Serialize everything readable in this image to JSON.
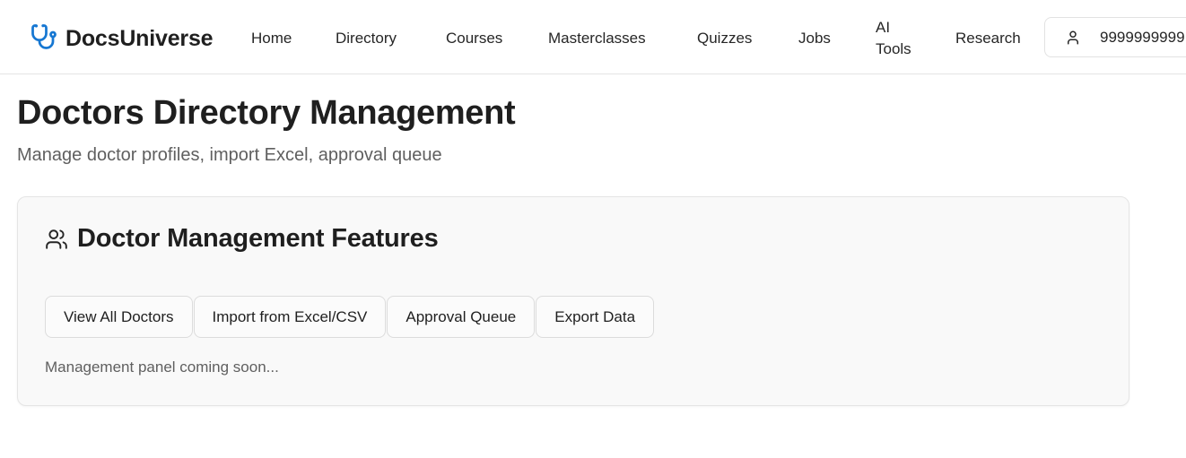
{
  "brand": {
    "name": "DocsUniverse",
    "icon": "stethoscope-icon",
    "color": "#1677d2"
  },
  "nav": {
    "home": "Home",
    "directory": "Directory",
    "courses": "Courses",
    "masterclasses": "Masterclasses",
    "quizzes": "Quizzes",
    "jobs": "Jobs",
    "ai_tools_line1": "AI",
    "ai_tools_line2": "Tools",
    "research": "Research"
  },
  "user": {
    "icon": "user-icon",
    "label": "9999999999"
  },
  "page": {
    "title": "Doctors Directory Management",
    "subtitle": "Manage doctor profiles, import Excel, approval queue"
  },
  "card": {
    "icon": "users-icon",
    "title": "Doctor Management Features",
    "buttons": {
      "view_all": "View All Doctors",
      "import": "Import from Excel/CSV",
      "approval": "Approval Queue",
      "export": "Export Data"
    },
    "note": "Management panel coming soon..."
  }
}
